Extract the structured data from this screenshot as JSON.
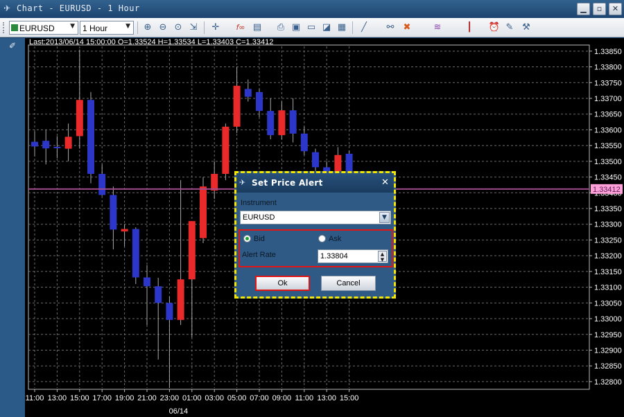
{
  "window": {
    "title": "Chart - EURUSD - 1 Hour",
    "buttons": [
      "minimize-button",
      "restore-button",
      "close-button"
    ]
  },
  "toolbar": {
    "instrument": "EURUSD",
    "timeframe": "1 Hour",
    "icons": [
      "zoom-in-icon",
      "zoom-out-icon",
      "zoom-reset-icon",
      "auto-scroll-icon",
      "crosshair-icon",
      "indicator-icon",
      "template-icon",
      "print-icon",
      "save-icon",
      "document-icon",
      "chart-type-icon",
      "line-tool-icon",
      "link-icon",
      "delete-icon",
      "fibonacci-icon",
      "candlestick-icon",
      "alert-icon",
      "properties-icon",
      "settings-icon"
    ]
  },
  "chart": {
    "info": "Last:2013/06/14 15:00:00 O=1.33524 H=1.33534 L=1.33403 C=1.33412",
    "current_price": "1.33412",
    "colors": {
      "bull": "#e82a2a",
      "bear": "#2c36c8",
      "grid": "#6b6b6b",
      "price_line": "#a04a8c",
      "price_tag": "#ff9fd8"
    }
  },
  "chart_data": {
    "type": "candlestick",
    "x_ticks": [
      "11:00",
      "13:00",
      "15:00",
      "17:00",
      "19:00",
      "21:00",
      "23:00",
      "01:00",
      "03:00",
      "05:00",
      "07:00",
      "09:00",
      "11:00",
      "13:00",
      "15:00"
    ],
    "date_label": "06/14",
    "y_ticks": [
      "1.33850",
      "1.33800",
      "1.33750",
      "1.33700",
      "1.33650",
      "1.33600",
      "1.33550",
      "1.33500",
      "1.33450",
      "1.33400",
      "1.33350",
      "1.33300",
      "1.33250",
      "1.33200",
      "1.33150",
      "1.33100",
      "1.33050",
      "1.33000",
      "1.32950",
      "1.32900",
      "1.32850",
      "1.32800"
    ],
    "ylim": [
      1.3278,
      1.33865
    ],
    "candles": [
      {
        "o": 1.33562,
        "h": 1.33595,
        "l": 1.33515,
        "c": 1.33547
      },
      {
        "o": 1.33565,
        "h": 1.336,
        "l": 1.3349,
        "c": 1.33541
      },
      {
        "o": 1.33546,
        "h": 1.3358,
        "l": 1.3351,
        "c": 1.33545
      },
      {
        "o": 1.3354,
        "h": 1.3362,
        "l": 1.335,
        "c": 1.33578
      },
      {
        "o": 1.3358,
        "h": 1.33855,
        "l": 1.3354,
        "c": 1.33695
      },
      {
        "o": 1.33695,
        "h": 1.3372,
        "l": 1.3343,
        "c": 1.3346
      },
      {
        "o": 1.3346,
        "h": 1.3349,
        "l": 1.3339,
        "c": 1.33393
      },
      {
        "o": 1.33393,
        "h": 1.3342,
        "l": 1.3322,
        "c": 1.33283
      },
      {
        "o": 1.33277,
        "h": 1.333,
        "l": 1.3323,
        "c": 1.33285
      },
      {
        "o": 1.33285,
        "h": 1.3329,
        "l": 1.3311,
        "c": 1.33131
      },
      {
        "o": 1.33131,
        "h": 1.3317,
        "l": 1.3298,
        "c": 1.33103
      },
      {
        "o": 1.33103,
        "h": 1.3313,
        "l": 1.3287,
        "c": 1.3305
      },
      {
        "o": 1.3305,
        "h": 1.3307,
        "l": 1.3278,
        "c": 1.32996
      },
      {
        "o": 1.32996,
        "h": 1.3344,
        "l": 1.3298,
        "c": 1.33125
      },
      {
        "o": 1.33125,
        "h": 1.333,
        "l": 1.3294,
        "c": 1.3331
      },
      {
        "o": 1.33256,
        "h": 1.3345,
        "l": 1.3324,
        "c": 1.3342
      },
      {
        "o": 1.33407,
        "h": 1.335,
        "l": 1.3338,
        "c": 1.3346
      },
      {
        "o": 1.3346,
        "h": 1.3362,
        "l": 1.3344,
        "c": 1.3361
      },
      {
        "o": 1.3361,
        "h": 1.338,
        "l": 1.3359,
        "c": 1.3374
      },
      {
        "o": 1.3373,
        "h": 1.3376,
        "l": 1.3369,
        "c": 1.33705
      },
      {
        "o": 1.3372,
        "h": 1.3373,
        "l": 1.3364,
        "c": 1.3366
      },
      {
        "o": 1.3366,
        "h": 1.337,
        "l": 1.3357,
        "c": 1.33583
      },
      {
        "o": 1.33583,
        "h": 1.3369,
        "l": 1.3357,
        "c": 1.33662
      },
      {
        "o": 1.33662,
        "h": 1.337,
        "l": 1.3356,
        "c": 1.33588
      },
      {
        "o": 1.33588,
        "h": 1.3361,
        "l": 1.3352,
        "c": 1.33532
      },
      {
        "o": 1.33529,
        "h": 1.3354,
        "l": 1.3345,
        "c": 1.33481
      },
      {
        "o": 1.33481,
        "h": 1.335,
        "l": 1.3344,
        "c": 1.33467
      },
      {
        "o": 1.33467,
        "h": 1.33545,
        "l": 1.3345,
        "c": 1.3352
      },
      {
        "o": 1.33524,
        "h": 1.33534,
        "l": 1.33403,
        "c": 1.33412
      }
    ]
  },
  "dialog": {
    "title": "Set Price Alert",
    "instrument_label": "Instrument",
    "instrument_value": "EURUSD",
    "bid_label": "Bid",
    "ask_label": "Ask",
    "side_selected": "Bid",
    "rate_label": "Alert Rate",
    "rate_value": "1.33804",
    "ok_label": "Ok",
    "cancel_label": "Cancel"
  }
}
